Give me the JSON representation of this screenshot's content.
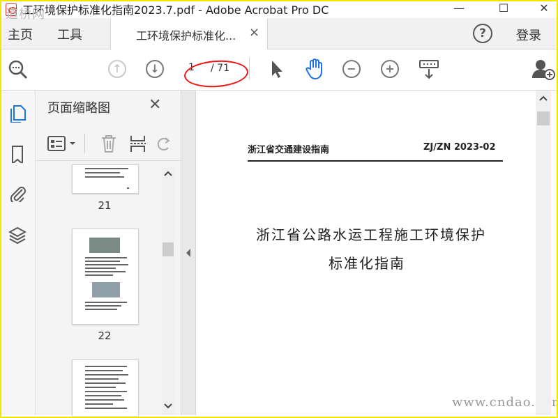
{
  "window": {
    "title": "工环境保护标准化指南2023.7.pdf - Adobe Acrobat Pro DC",
    "minimize": "—",
    "maximize": "☐",
    "close": "✕"
  },
  "watermarks": {
    "top_left": "道桥网",
    "bottom_right": "www.cndao.com"
  },
  "tabs": {
    "home": "主页",
    "tools": "工具",
    "document": "工环境保护标准化...",
    "close": "×",
    "help": "?",
    "login": "登录"
  },
  "toolbar": {
    "page_current": "1",
    "page_total": "/ 71",
    "icons": [
      "search-icon",
      "prev-page-icon",
      "next-page-icon",
      "select-cursor-icon",
      "hand-tool-icon",
      "zoom-out-icon",
      "zoom-in-icon",
      "scroll-mode-icon",
      "share-user-icon"
    ]
  },
  "left_rail": {
    "icons": [
      "pages-icon",
      "bookmark-icon",
      "attachment-icon",
      "layers-icon"
    ]
  },
  "thumbnail_panel": {
    "title": "页面缩略图",
    "close": "✕",
    "pages": [
      "21",
      "22"
    ]
  },
  "document": {
    "header_left": "浙江省交通建设指南",
    "header_right": "ZJ/ZN 2023-02",
    "title_line1": "浙江省公路水运工程施工环境保护",
    "title_line2": "标准化指南"
  },
  "colors": {
    "accent_blue": "#1a73e8",
    "highlight_red": "#e11111",
    "frame_yellow": "#f2e600"
  }
}
